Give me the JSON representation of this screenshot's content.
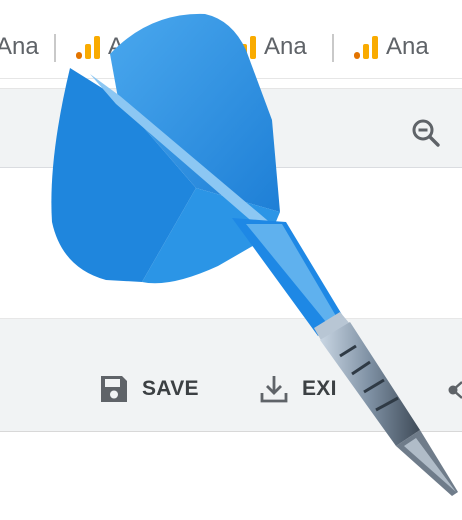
{
  "tabs": [
    {
      "label": "Ana"
    },
    {
      "label": "An"
    },
    {
      "label": "Ana"
    },
    {
      "label": "Ana"
    }
  ],
  "toolbar": {
    "save_label": "SAVE",
    "export_label": "EXI"
  },
  "colors": {
    "ga_orange": "#f9ab00",
    "ga_dark": "#e37400",
    "dart_blue": "#1e88e5",
    "toolbar_bg": "#f1f3f4"
  },
  "icons": [
    "analytics-icon",
    "zoom-out-icon",
    "save-icon",
    "download-icon",
    "share-icon",
    "dart-icon"
  ]
}
